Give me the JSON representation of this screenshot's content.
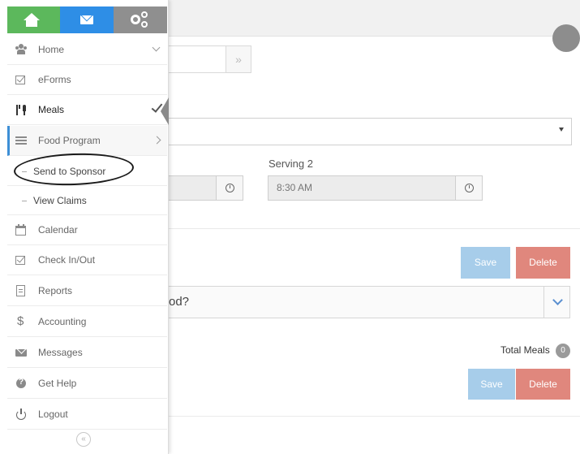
{
  "topbar": {
    "home_icon": "home-icon",
    "mail_icon": "envelope-icon",
    "settings_icon": "gears-icon",
    "colors": {
      "home": "#5cb85c",
      "mail": "#2e8ee6",
      "settings": "#8f8f8f"
    }
  },
  "sidebar": {
    "items": [
      {
        "label": "Home",
        "icon": "users-icon"
      },
      {
        "label": "eForms",
        "icon": "checkbox-icon"
      },
      {
        "label": "Meals",
        "icon": "utensils-icon"
      },
      {
        "label": "Food Program",
        "icon": "list-icon"
      },
      {
        "label": "Calendar",
        "icon": "calendar-icon"
      },
      {
        "label": "Check In/Out",
        "icon": "checkbox-icon"
      },
      {
        "label": "Reports",
        "icon": "document-icon"
      },
      {
        "label": "Accounting",
        "icon": "dollar-icon"
      },
      {
        "label": "Messages",
        "icon": "envelope-icon"
      },
      {
        "label": "Get Help",
        "icon": "help-icon"
      },
      {
        "label": "Logout",
        "icon": "power-icon"
      }
    ],
    "food_program_sub": [
      {
        "label": "Send to Sponsor"
      },
      {
        "label": "View Claims"
      }
    ],
    "collapse_glyph": "«",
    "active_accent": "#3d8fd6"
  },
  "main": {
    "go_glyph": "»",
    "serving2_label": "Serving 2",
    "serving2_time": "8:30 AM",
    "question_text": "od?",
    "save_label": "Save",
    "delete_label": "Delete",
    "total_meals_label": "Total Meals",
    "total_meals_count": "0",
    "save_color": "#a7cdea",
    "delete_color": "#e0877d"
  }
}
